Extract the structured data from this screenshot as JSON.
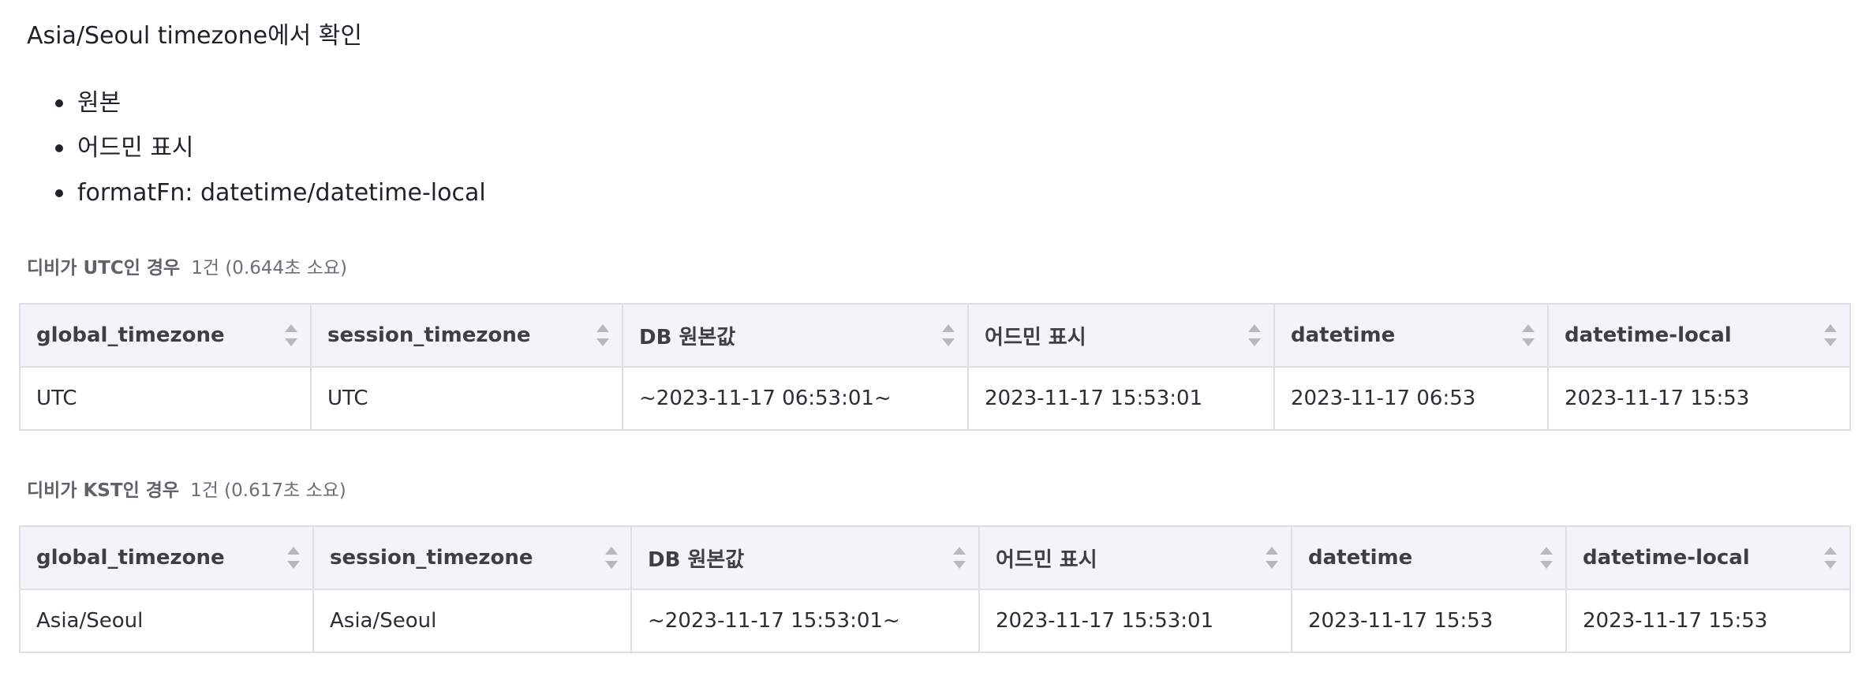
{
  "heading": "Asia/Seoul timezone에서 확인",
  "bullets": [
    "원본",
    "어드민 표시",
    "formatFn: datetime/datetime-local"
  ],
  "tables": [
    {
      "title": "디비가 UTC인 경우",
      "meta": "1건 (0.644초 소요)",
      "columns": [
        "global_timezone",
        "session_timezone",
        "DB 원본값",
        "어드민 표시",
        "datetime",
        "datetime-local"
      ],
      "rows": [
        [
          "UTC",
          "UTC",
          "~2023-11-17 06:53:01~",
          "2023-11-17 15:53:01",
          "2023-11-17 06:53",
          "2023-11-17 15:53"
        ]
      ]
    },
    {
      "title": "디비가 KST인 경우",
      "meta": "1건 (0.617초 소요)",
      "columns": [
        "global_timezone",
        "session_timezone",
        "DB 원본값",
        "어드민 표시",
        "datetime",
        "datetime-local"
      ],
      "rows": [
        [
          "Asia/Seoul",
          "Asia/Seoul",
          "~2023-11-17 15:53:01~",
          "2023-11-17 15:53:01",
          "2023-11-17 15:53",
          "2023-11-17 15:53"
        ]
      ]
    }
  ],
  "icons": {
    "sort": "sort-icon"
  },
  "colors": {
    "header_bg": "#f3f4f7",
    "border": "#dcdfe3",
    "caption_text": "#5f6368"
  }
}
